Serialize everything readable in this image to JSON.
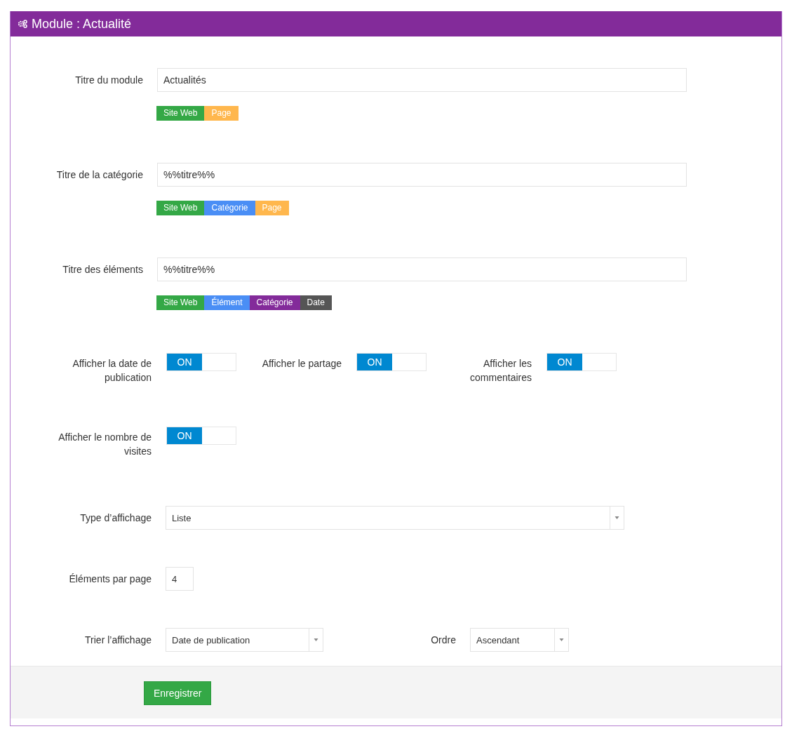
{
  "panel": {
    "title": "Module : Actualité"
  },
  "title_fields": [
    {
      "label": "Titre du module",
      "value": "Actualités",
      "tags": [
        {
          "text": "Site Web",
          "color": "#34a846"
        },
        {
          "text": "Page",
          "color": "#ffb74d"
        }
      ]
    },
    {
      "label": "Titre de la catégorie",
      "value": "%%titre%%",
      "tags": [
        {
          "text": "Site Web",
          "color": "#34a846"
        },
        {
          "text": "Catégorie",
          "color": "#4a8ef5"
        },
        {
          "text": "Page",
          "color": "#ffb74d"
        }
      ]
    },
    {
      "label": "Titre des éléments",
      "value": "%%titre%%",
      "tags": [
        {
          "text": "Site Web",
          "color": "#34a846"
        },
        {
          "text": "Élément",
          "color": "#4a8ef5"
        },
        {
          "text": "Catégorie",
          "color": "#832b9a"
        },
        {
          "text": "Date",
          "color": "#555555"
        }
      ]
    }
  ],
  "toggle_rows": [
    [
      {
        "label": "Afficher la date de publication",
        "state": "ON",
        "on": true
      },
      {
        "label": "Afficher le partage",
        "state": "ON",
        "on": true
      },
      {
        "label": "Afficher les commentaires",
        "state": "ON",
        "on": true
      }
    ],
    [
      {
        "label": "Afficher le nombre de visites",
        "state": "ON",
        "on": true
      }
    ]
  ],
  "display_type": {
    "label": "Type d’affichage",
    "value": "Liste"
  },
  "per_page": {
    "label": "Éléments par page",
    "value": "4"
  },
  "sort": {
    "label": "Trier l’affichage",
    "value": "Date de publication"
  },
  "order": {
    "label": "Ordre",
    "value": "Ascendant"
  },
  "save_button": "Enregistrer"
}
